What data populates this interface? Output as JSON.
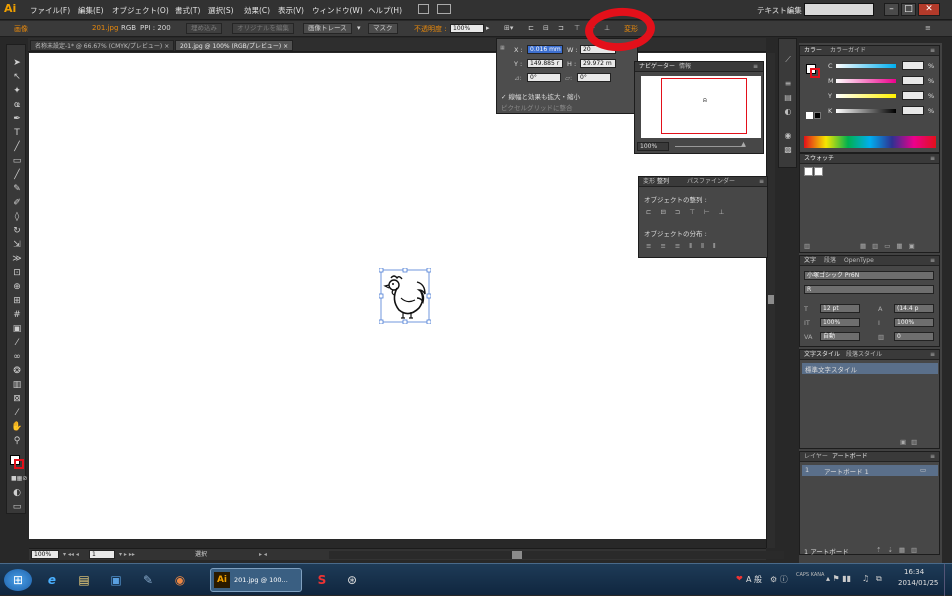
{
  "app": {
    "logo": "Ai"
  },
  "menu": [
    "ファイル(F)",
    "編集(E)",
    "オブジェクト(O)",
    "書式(T)",
    "選択(S)",
    "効果(C)",
    "表示(V)",
    "ウィンドウ(W)",
    "ヘルプ(H)"
  ],
  "workspace": {
    "label": "テキスト編集 ▾"
  },
  "window_buttons": {
    "minimize": "–",
    "maximize": "□",
    "close": "✕"
  },
  "control_bar": {
    "type_label": "画像",
    "file": "201.jpg",
    "mode": "RGB",
    "ppi": "PPI : 200",
    "embed": "埋め込み",
    "edit_original": "オリジナルを編集",
    "image_trace": "画像トレース",
    "mask": "マスク",
    "opacity_label": "不透明度 :",
    "opacity_value": "100%",
    "transform_label": "変形"
  },
  "doc_tabs": [
    "名称未設定-1* @ 66.67% (CMYK/プレビュー)",
    "201.jpg @ 100% (RGB/プレビュー)"
  ],
  "transform_panel": {
    "x_label": "X :",
    "x_value": "0.016 mm",
    "w_label": "W :",
    "w_value": "20",
    "y_label": "Y :",
    "y_value": "149.885 r",
    "h_label": "H :",
    "h_value": "29.972 m",
    "angle_value": "0°",
    "shear_value": "0°",
    "scale_strokes": "✓ 線幅と効果も拡大・縮小",
    "pixel_grid": "ピクセルグリッドに整合"
  },
  "navigator": {
    "tab_active": "ナビゲーター",
    "tab_info": "情報",
    "zoom": "100%"
  },
  "align_panel": {
    "tabs": [
      "変形",
      "整列",
      "パスファインダー"
    ],
    "align_objects": "オブジェクトの整列 :",
    "distribute_objects": "オブジェクトの分布 :"
  },
  "color_panel": {
    "tabs": [
      "カラー",
      "カラーガイド"
    ],
    "channels": [
      "C",
      "M",
      "Y",
      "K"
    ],
    "unit": "%"
  },
  "swatches": {
    "tab": "スウォッチ"
  },
  "character_panel": {
    "tabs": [
      "文字",
      "段落",
      "OpenType"
    ],
    "font": "小塚ゴシック Pr6N",
    "style": "R",
    "size": "12 pt",
    "leading": "(14.4 p",
    "vscale": "100%",
    "hscale": "100%",
    "kerning": "自動",
    "tracking": "0"
  },
  "char_style_panel": {
    "tabs": [
      "文字スタイル",
      "段落スタイル"
    ],
    "item": "標準文字スタイル"
  },
  "layers_panel": {
    "tabs": [
      "レイヤー",
      "アートボード"
    ],
    "row_num": "1",
    "row_name": "アートボード 1",
    "footer": "1 アートボード"
  },
  "status_bar": {
    "zoom": "100%",
    "page": "1",
    "tool": "選択"
  },
  "taskbar": {
    "ai_label": "201.jpg @ 100...",
    "time": "16:34",
    "date": "2014/01/25",
    "ime": "A 般"
  },
  "colors": {
    "accent": "#e8890c",
    "annotation": "#e3101a",
    "selection": "#4d7dd6",
    "panel": "#474747"
  }
}
